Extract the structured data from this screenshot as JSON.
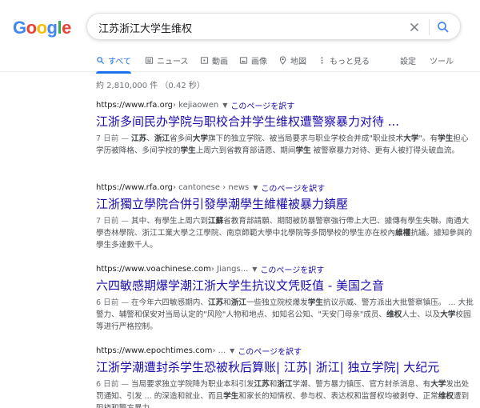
{
  "logo": [
    "G",
    "o",
    "o",
    "g",
    "l",
    "e"
  ],
  "logo_colors": [
    "#4285F4",
    "#EA4335",
    "#FBBC05",
    "#4285F4",
    "#34A853",
    "#EA4335"
  ],
  "search": {
    "query": "江苏浙江大学生维权"
  },
  "tabs": [
    {
      "label": "すべて",
      "icon": "search-icon",
      "active": true
    },
    {
      "label": "ニュース",
      "icon": "news-icon"
    },
    {
      "label": "動画",
      "icon": "video-icon"
    },
    {
      "label": "画像",
      "icon": "image-icon"
    },
    {
      "label": "地図",
      "icon": "map-pin-icon"
    },
    {
      "label": "もっと見る",
      "icon": "more-vert-icon"
    },
    {
      "label": "設定"
    },
    {
      "label": "ツール"
    }
  ],
  "stats": "約 2,810,000 件 （0.42 秒）",
  "accent": "#1a73e8",
  "link_color": "#1a0dab",
  "results": [
    {
      "url": "https://www.rfa.org",
      "path": " › kejiaowen",
      "translate": "このページを訳す",
      "title": "江浙多间民办学院与职校合并学生维权遭警察暴力对待 ...",
      "date": "7 日前 — ",
      "snippet_html": "<b>江苏</b>、<b>浙江</b>省多间<b>大学</b>旗下的独立学院、被当局要求与职业学校合并成\"职业技术<b>大学</b>\"。有<b>学生</b>担心学历被降格、多间学校的<b>学生</b>上周六到省教育部请愿、期间<b>学生</b> 被警察暴力对待、更有人被打得头破血流。"
    },
    {
      "url": "https://www.rfa.org",
      "path": " › cantonese › news",
      "translate": "このページを訳す",
      "title": "江浙獨立學院合併引發學潮學生維權被暴力鎮壓",
      "date": "7 日前 — ",
      "snippet_html": "其中、有學生上周六到<b>江蘇</b>省教育部請願、期間被防暴警察強行帶上大巴、據傳有學生失聯。南通大學杏林學院、浙江工業大學之江學院、南京師範大學中北學院等多間學校的學生亦在校內<b>維權</b>抗議。據知參與的學生多達數千人。"
    },
    {
      "url": "https://www.voachinese.com",
      "path": " › Jiangs...",
      "translate": "このページを訳す",
      "title": "六四敏感期爆学潮江浙大学生抗议文凭贬值 - 美国之音",
      "date": "6 日前 — ",
      "snippet_html": "在今年六四敏感期内、<b>江苏</b>和<b>浙江</b>一些独立院校爆发<b>学生</b>抗议示威、警方派出大批警察镇压。 ... 大批警力、辅警和保安对当局认定的\"风险\"人物和地点、如知名公知、\"天安门母亲\"成员、<b>维权</b>人士、以及<b>大学</b>校园等进行严格控制。"
    },
    {
      "url": "https://www.epochtimes.com",
      "path": " › ...",
      "translate": "このページを訳す",
      "title": "江浙学潮遭封杀学生恐被秋后算账| 江苏| 浙江| 独立学院| 大纪元",
      "date": "6 日前 — ",
      "snippet_html": "当局要求独立学院降为职业本科引发<b>江苏</b>和<b>浙江</b>学潮、警方暴力镇压、官方封杀消息、有<b>大学</b>发出处罚通知、引发 ... 的深造和就业、而且<b>学生</b>和家长的知情权、参与权、表达权和监督权均被剥夺、正常<b>维权</b>遭到阻挠和警方暴力。"
    }
  ]
}
